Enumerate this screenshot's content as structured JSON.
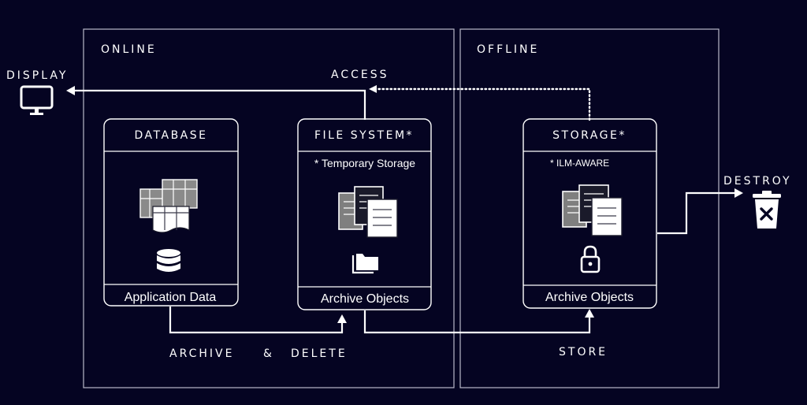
{
  "regions": {
    "online": "ONLINE",
    "offline": "OFFLINE"
  },
  "endpoints": {
    "display": "DISPLAY",
    "destroy": "DESTROY"
  },
  "flows": {
    "access": "ACCESS",
    "archive_and_delete": {
      "word1": "ARCHIVE",
      "amp": "&",
      "word2": "DELETE"
    },
    "store": "STORE"
  },
  "cards": {
    "database": {
      "title": "DATABASE",
      "footer": "Application Data",
      "icons": [
        "spreadsheet-stack-icon",
        "database-icon"
      ]
    },
    "file_system": {
      "title": "FILE SYSTEM*",
      "note": "* Temporary Storage",
      "footer": "Archive Objects",
      "icons": [
        "documents-icon",
        "folder-icon"
      ]
    },
    "storage": {
      "title": "STORAGE*",
      "note": "* ILM-AWARE",
      "footer": "Archive Objects",
      "icons": [
        "documents-icon",
        "lock-icon"
      ]
    }
  },
  "icons": {
    "display": "monitor-icon",
    "destroy": "trash-can-icon"
  },
  "colors": {
    "background": "#050422",
    "foreground": "#ffffff",
    "region_border": "#b9b9c8"
  }
}
